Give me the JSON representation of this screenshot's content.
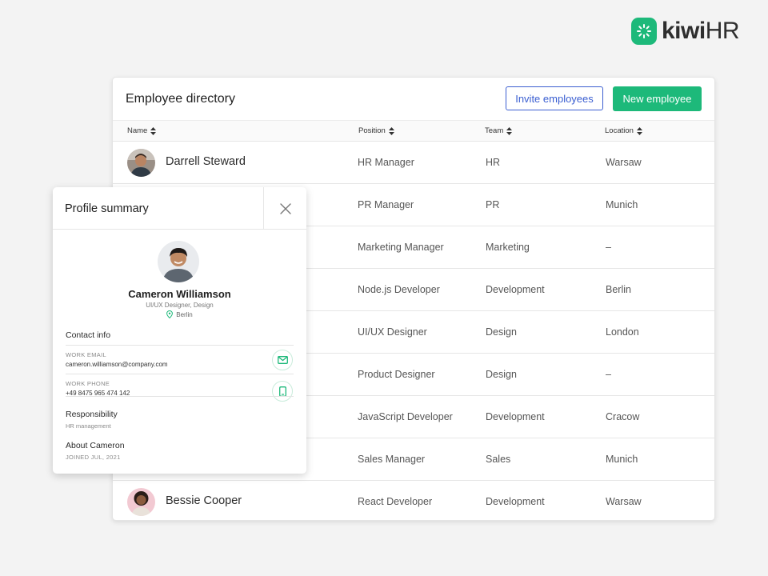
{
  "brand": {
    "name_bold": "kiwi",
    "name_rest": "HR",
    "accent": "#1db97a"
  },
  "directory": {
    "title": "Employee directory",
    "invite_label": "Invite employees",
    "new_label": "New employee",
    "columns": [
      "Name",
      "Position",
      "Team",
      "Location"
    ],
    "rows": [
      {
        "name": "Darrell Steward",
        "position": "HR Manager",
        "team": "HR",
        "location": "Warsaw"
      },
      {
        "name": "",
        "position": "PR Manager",
        "team": "PR",
        "location": "Munich"
      },
      {
        "name": "",
        "position": "Marketing Manager",
        "team": "Marketing",
        "location": "–"
      },
      {
        "name": "",
        "position": "Node.js Developer",
        "team": "Development",
        "location": "Berlin"
      },
      {
        "name": "",
        "position": "UI/UX Designer",
        "team": "Design",
        "location": "London"
      },
      {
        "name": "",
        "position": "Product Designer",
        "team": "Design",
        "location": "–"
      },
      {
        "name": "",
        "position": "JavaScript Developer",
        "team": "Development",
        "location": "Cracow"
      },
      {
        "name": "",
        "position": "Sales Manager",
        "team": "Sales",
        "location": "Munich"
      },
      {
        "name": "Bessie Cooper",
        "position": "React Developer",
        "team": "Development",
        "location": "Warsaw"
      }
    ]
  },
  "profile": {
    "title": "Profile summary",
    "name": "Cameron Williamson",
    "role": "UI/UX Designer, Design",
    "location": "Berlin",
    "contact_title": "Contact info",
    "email_label": "WORK EMAIL",
    "email": "cameron.williamson@company.com",
    "phone_label": "WORK PHONE",
    "phone": "+49 8475 965 474 142",
    "responsibility_title": "Responsibility",
    "responsibility": "HR management",
    "about_title": "About Cameron",
    "joined": "JOINED JUL, 2021"
  }
}
